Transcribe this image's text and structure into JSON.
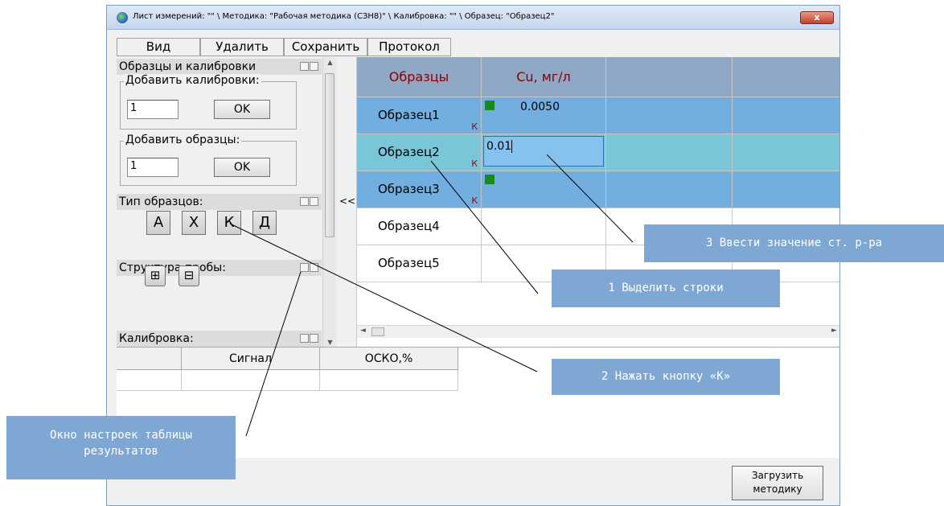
{
  "window": {
    "title": "Лист измерений: \"\" \\ Методика: \"Рабочая методика (СЗН8)\" \\ Калибровка: \"\" \\ Образец: \"Образец2\"",
    "close_label": "x"
  },
  "menu": {
    "view": "Вид",
    "delete": "Удалить",
    "save": "Сохранить",
    "protocol": "Протокол"
  },
  "panel": {
    "samples_header": "Образцы и калибровки",
    "add_calib_label": "Добавить калибровки:",
    "add_calib_value": "1",
    "add_samples_label": "Добавить образцы:",
    "add_samples_value": "1",
    "ok": "OK",
    "type_header": "Тип образцов:",
    "type_buttons": [
      "А",
      "Х",
      "К",
      "Д"
    ],
    "structure_header": "Структура пробы:",
    "calibration_header": "Калибровка:",
    "collapse": "<<"
  },
  "grid": {
    "col_samples": "Образцы",
    "col_cu": "Cu, мг/л",
    "rows": [
      {
        "name": "Образец1",
        "k": "К",
        "value": "0.0050",
        "state": "selected"
      },
      {
        "name": "Образец2",
        "k": "К",
        "value": "0.01",
        "state": "editing"
      },
      {
        "name": "Образец3",
        "k": "К",
        "value": "",
        "state": "selected"
      },
      {
        "name": "Образец4",
        "k": "",
        "value": "",
        "state": "normal"
      },
      {
        "name": "Образец5",
        "k": "",
        "value": "",
        "state": "normal"
      }
    ]
  },
  "bottom": {
    "col_signal": "Сигнал",
    "col_osko": "ОСКО,%",
    "load_button": "Загрузить методику"
  },
  "callouts": {
    "step1": "1 Выделить строки",
    "step2": "2 Нажать кнопку «К»",
    "step3": "3 Ввести значение ст. р-ра",
    "settings": "Окно настроек таблицы результатов"
  },
  "colors": {
    "selected_row": "#72aee0",
    "editing_row": "#78c6d8",
    "header": "#8fa8c5",
    "callout": "#7fa7d3",
    "green": "#178a1c"
  }
}
